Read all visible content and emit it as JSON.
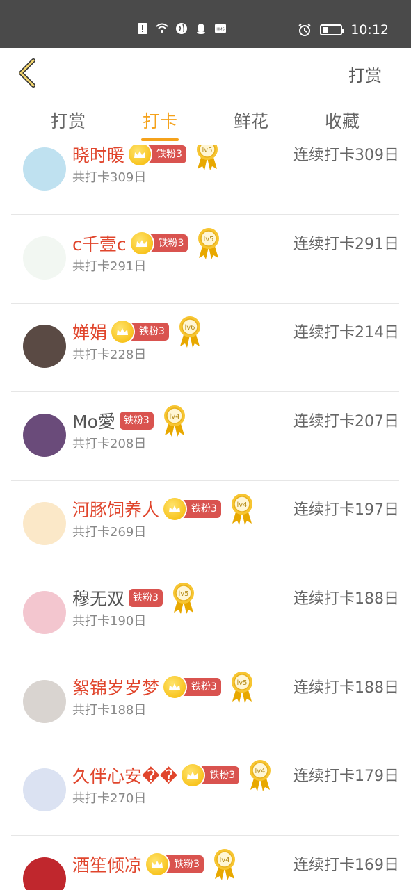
{
  "status_bar": {
    "time": "10:12"
  },
  "header": {
    "right_action": "打赏"
  },
  "tabs": [
    {
      "label": "打赏",
      "active": false
    },
    {
      "label": "打卡",
      "active": true
    },
    {
      "label": "鲜花",
      "active": false
    },
    {
      "label": "收藏",
      "active": false
    }
  ],
  "users": [
    {
      "name": "晓时暖",
      "name_color": "red",
      "crown": true,
      "fan_badge": "铁粉3",
      "level": "lv5",
      "total": "共打卡309日",
      "streak": "连续打卡309日",
      "avatar": "#bfe1f0"
    },
    {
      "name": "c千壹c",
      "name_color": "red",
      "crown": true,
      "fan_badge": "铁粉3",
      "level": "lv5",
      "total": "共打卡291日",
      "streak": "连续打卡291日",
      "avatar": "#f2f7f2"
    },
    {
      "name": "婵娟",
      "name_color": "red",
      "crown": true,
      "fan_badge": "铁粉3",
      "level": "lv6",
      "total": "共打卡228日",
      "streak": "连续打卡214日",
      "avatar": "#5a4a44"
    },
    {
      "name": "Mo愛",
      "name_color": "gray",
      "crown": false,
      "fan_badge": "铁粉3",
      "level": "lv4",
      "total": "共打卡208日",
      "streak": "连续打卡207日",
      "avatar": "#6a4b7a"
    },
    {
      "name": "河豚饲养人",
      "name_color": "red",
      "crown": true,
      "fan_badge": "铁粉3",
      "level": "lv4",
      "total": "共打卡269日",
      "streak": "连续打卡197日",
      "avatar": "#fbe8c8"
    },
    {
      "name": "穆无双",
      "name_color": "gray",
      "crown": false,
      "fan_badge": "铁粉3",
      "level": "lv5",
      "total": "共打卡190日",
      "streak": "连续打卡188日",
      "avatar": "#f3c6cf"
    },
    {
      "name": "絮锦岁岁梦",
      "name_color": "red",
      "crown": true,
      "fan_badge": "铁粉3",
      "level": "lv5",
      "total": "共打卡188日",
      "streak": "连续打卡188日",
      "avatar": "#d9d4d0"
    },
    {
      "name": "久伴心安��",
      "name_color": "red",
      "crown": true,
      "fan_badge": "铁粉3",
      "level": "lv4",
      "total": "共打卡270日",
      "streak": "连续打卡179日",
      "avatar": "#dbe2f2"
    },
    {
      "name": "酒笙倾凉",
      "name_color": "red",
      "crown": true,
      "fan_badge": "铁粉3",
      "level": "lv4",
      "total": "",
      "streak": "连续打卡169日",
      "avatar": "#c0272d"
    }
  ]
}
